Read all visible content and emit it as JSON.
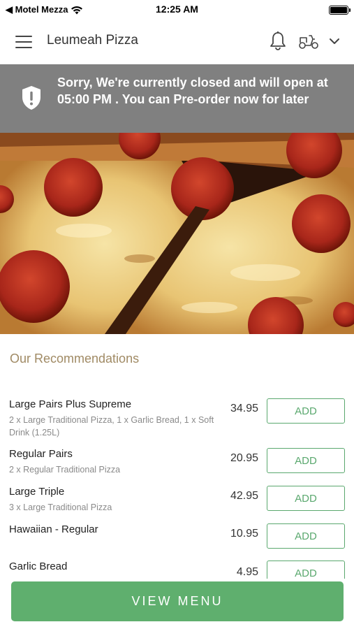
{
  "status_bar": {
    "back_label": "◀ Motel Mezza",
    "time": "12:25 AM"
  },
  "header": {
    "title": "Leumeah Pizza",
    "menu_icon": "hamburger-icon",
    "notification_icon": "bell-icon",
    "delivery_icon": "scooter-icon",
    "dropdown_icon": "chevron-down-icon"
  },
  "banner": {
    "icon": "shield-alert-icon",
    "message": "Sorry, We're currently closed and will open at 05:00 PM . You can Pre-order now for later"
  },
  "recommendations": {
    "title": "Our Recommendations",
    "items": [
      {
        "name": "Large Pairs Plus Supreme",
        "description": "2 x Large Traditional Pizza, 1 x Garlic Bread, 1 x Soft Drink (1.25L)",
        "price": "34.95",
        "button": "ADD"
      },
      {
        "name": "Regular Pairs",
        "description": "2 x Regular Traditional Pizza",
        "price": "20.95",
        "button": "ADD"
      },
      {
        "name": "Large Triple",
        "description": "3 x Large Traditional Pizza",
        "price": "42.95",
        "button": "ADD"
      },
      {
        "name": "Hawaiian - Regular",
        "description": "",
        "price": "10.95",
        "button": "ADD"
      },
      {
        "name": "Garlic Bread",
        "description": "",
        "price": "4.95",
        "button": "ADD"
      }
    ]
  },
  "footer": {
    "view_menu_label": "VIEW MENU"
  },
  "colors": {
    "accent_green": "#5faf6e",
    "banner_gray": "#808080",
    "section_title": "#a08a64"
  }
}
